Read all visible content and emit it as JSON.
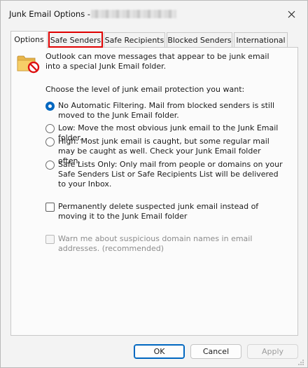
{
  "window": {
    "title": "Junk Email Options - ",
    "title_account": "",
    "close_icon": "close-icon"
  },
  "tabs": [
    {
      "label": "Options",
      "active": true
    },
    {
      "label": "Safe Senders",
      "highlighted": true
    },
    {
      "label": "Safe Recipients"
    },
    {
      "label": "Blocked Senders"
    },
    {
      "label": "International"
    }
  ],
  "options": {
    "intro": "Outlook can move messages that appear to be junk email into a special Junk Email folder.",
    "prompt": "Choose the level of junk email protection you want:",
    "levels": [
      {
        "label": "No Automatic Filtering. Mail from blocked senders is still moved to the Junk Email folder.",
        "checked": true
      },
      {
        "label": "Low: Move the most obvious junk email to the Junk Email folder.",
        "checked": false
      },
      {
        "label": "High: Most junk email is caught, but some regular mail may be caught as well. Check your Junk Email folder often.",
        "checked": false
      },
      {
        "label": "Safe Lists Only: Only mail from people or domains on your Safe Senders List or Safe Recipients List will be delivered to your Inbox.",
        "checked": false
      }
    ],
    "permanently_delete": {
      "label": "Permanently delete suspected junk email instead of moving it to the Junk Email folder",
      "checked": false
    },
    "warn_domains": {
      "label": "Warn me about suspicious domain names in email addresses. (recommended)",
      "checked": false,
      "enabled": false
    }
  },
  "buttons": {
    "ok": "OK",
    "cancel": "Cancel",
    "apply": "Apply"
  },
  "colors": {
    "accent": "#0067c0",
    "highlight": "#e00000"
  }
}
